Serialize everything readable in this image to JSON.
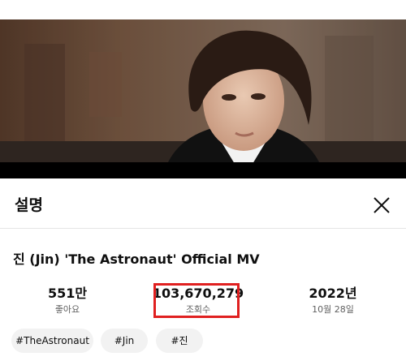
{
  "panel": {
    "title": "설명"
  },
  "video": {
    "title": "진 (Jin) 'The Astronaut' Official MV"
  },
  "stats": {
    "likes": {
      "value": "551만",
      "label": "좋아요"
    },
    "views": {
      "value": "103,670,279",
      "label": "조회수"
    },
    "date": {
      "value": "2022년",
      "label": "10월 28일"
    }
  },
  "hashtags": [
    "#TheAstronaut",
    "#Jin",
    "#진"
  ],
  "icons": {
    "close": "close-icon"
  },
  "colors": {
    "highlight": "#e02020",
    "tag_bg": "#f2f2f2",
    "text": "#0f0f0f",
    "muted": "#606060"
  }
}
